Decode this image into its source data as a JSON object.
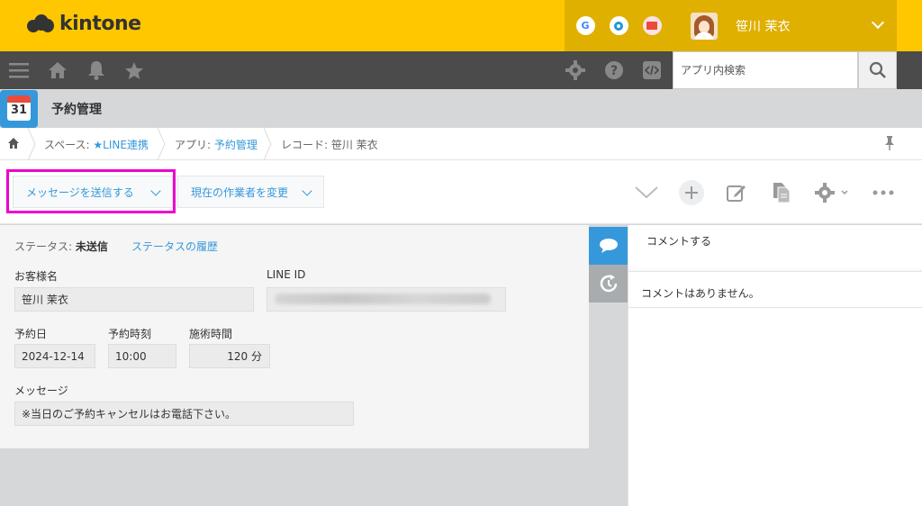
{
  "header": {
    "logo_text": "kintone",
    "top_icons": [
      {
        "name": "google-icon",
        "label": "G",
        "color": "#4285f4"
      },
      {
        "name": "circle-icon",
        "label": "○",
        "color": "#1a9ad6"
      },
      {
        "name": "mail-icon",
        "label": "✉",
        "color": "#e74c3c"
      }
    ],
    "user_name": "笹川 茉衣",
    "accent_color": "#fec700"
  },
  "nav": {
    "icons": [
      "menu-icon",
      "home-icon",
      "bell-icon",
      "star-icon"
    ],
    "right_icons": [
      "gear-icon",
      "help-icon",
      "code-icon"
    ],
    "search_placeholder": "アプリ内検索"
  },
  "app": {
    "title": "予約管理",
    "icon_number": "31"
  },
  "breadcrumb": {
    "space_prefix": "スペース: ",
    "space_name": "★LINE連携",
    "app_prefix": "アプリ: ",
    "app_name": "予約管理",
    "record_prefix": "レコード: ",
    "record_name": "笹川 茉衣"
  },
  "toolbar": {
    "send_message_label": "メッセージを送信する",
    "change_assignee_label": "現在の作業者を変更"
  },
  "record": {
    "status_label": "ステータス: ",
    "status_value": "未送信",
    "status_history_link": "ステータスの履歴",
    "fields": {
      "customer_name_label": "お客様名",
      "customer_name_value": "笹川 茉衣",
      "line_id_label": "LINE ID",
      "reservation_date_label": "予約日",
      "reservation_date_value": "2024-12-14",
      "reservation_time_label": "予約時刻",
      "reservation_time_value": "10:00",
      "treatment_time_label": "施術時間",
      "treatment_time_value": "120",
      "treatment_time_unit": "分",
      "message_label": "メッセージ",
      "message_value": "※当日のご予約キャンセルはお電話下さい。"
    }
  },
  "comments": {
    "comment_prompt": "コメントする",
    "no_comments": "コメントはありません。"
  }
}
